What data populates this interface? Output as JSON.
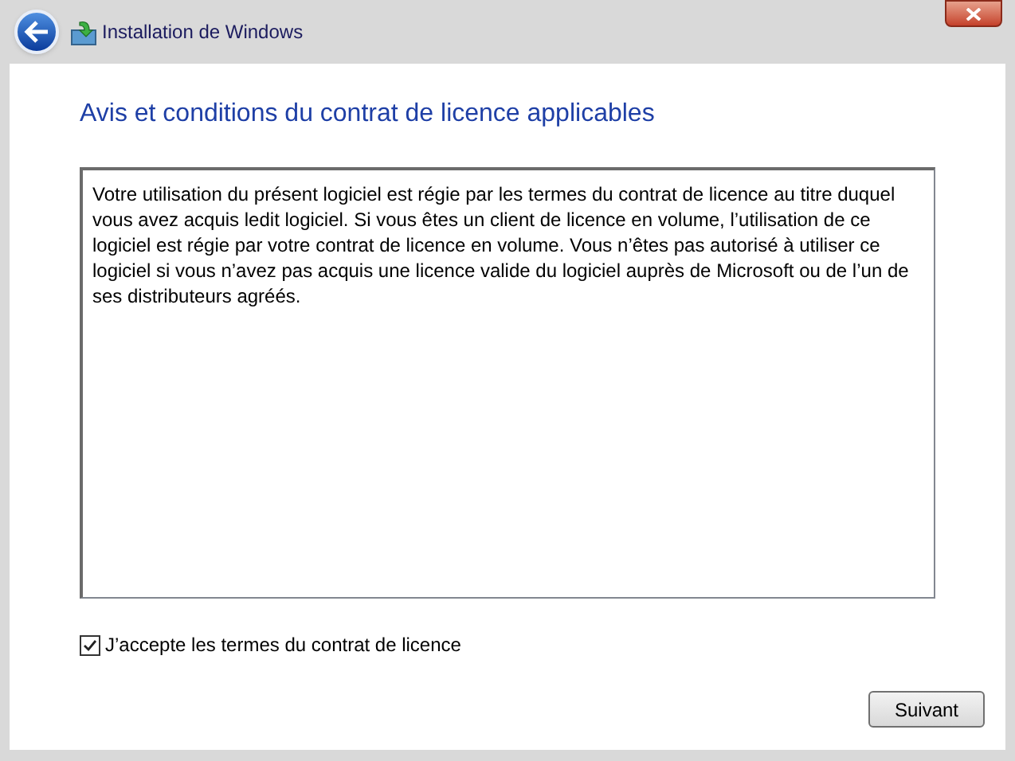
{
  "window": {
    "title": "Installation de Windows"
  },
  "heading": "Avis et conditions du contrat de licence applicables",
  "license_text": "Votre utilisation du présent logiciel est régie par les termes du contrat de licence au titre duquel vous avez acquis ledit logiciel. Si vous êtes un client de licence en volume, l’utilisation de ce logiciel est régie par votre contrat de licence en volume. Vous n’êtes pas autorisé à utiliser ce logiciel si vous n’avez pas acquis une licence valide du logiciel auprès de Microsoft ou de l’un de ses distributeurs agréés.",
  "accept": {
    "label": "J’accepte les termes du contrat de licence",
    "checked": true
  },
  "buttons": [
    {
      "label": "Suivant"
    }
  ]
}
